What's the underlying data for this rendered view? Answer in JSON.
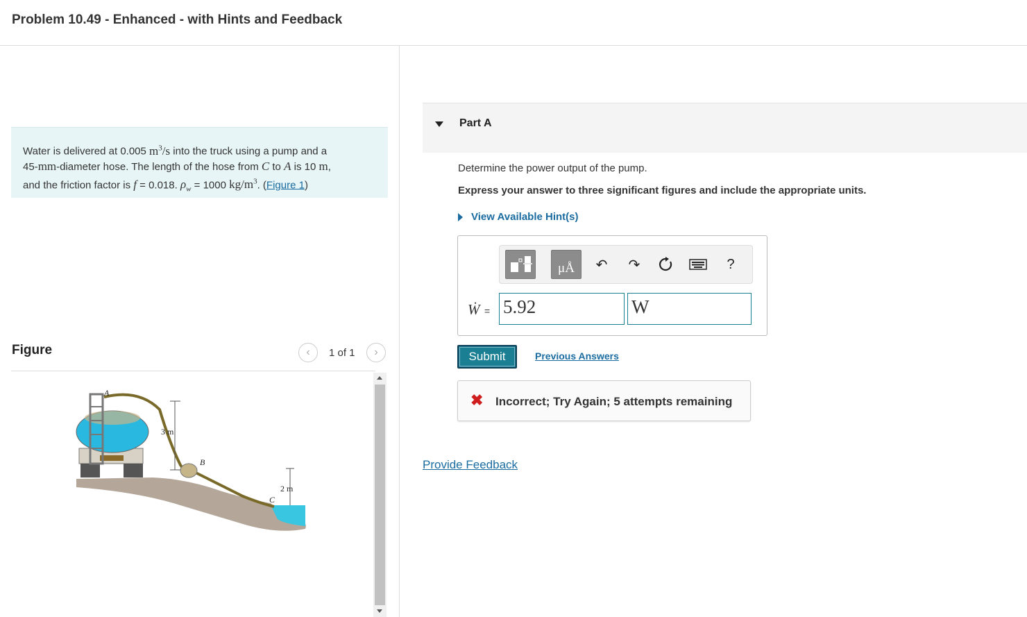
{
  "header": {
    "title": "Problem 10.49 - Enhanced - with Hints and Feedback"
  },
  "problem": {
    "t1": "Water is delivered at 0.005 ",
    "m3s_m": "m",
    "m3s_exp": "3",
    "m3s_s": "/s",
    "t2": " into the truck using a pump and a",
    "mm": "45-",
    "mm_unit": "mm",
    "t3": "-diameter hose. The length of the hose from ",
    "c": "C",
    "t4": " to ",
    "a": "A",
    "t5": " is 10 ",
    "m": "m",
    "t6": ",",
    "t7": "and the friction factor is ",
    "f": "f",
    "t8": " = 0.018. ",
    "rho": "ρ",
    "rho_sub": "w",
    "t9": " = 1000 ",
    "kg": "kg/m",
    "kg_exp": "3",
    "t10": ". (",
    "fig_link": "Figure 1",
    "t11": ")"
  },
  "figure": {
    "label": "Figure",
    "pager": "1 of 1",
    "prev_icon": "chevron-left-icon",
    "next_icon": "chevron-right-icon",
    "labels": {
      "a": "A",
      "b": "B",
      "c": "C",
      "h1": "3 m",
      "h2": "2 m"
    },
    "colors": {
      "tank": "#29b8e0",
      "water": "#38c6e0",
      "ground": "#b4a79a",
      "hose": "#7a6a2a"
    }
  },
  "part_a": {
    "title": "Part A",
    "question": "Determine the power output of the pump.",
    "instruction": "Express your answer to three significant figures and include the appropriate units.",
    "hint_label": "View Available Hint(s)",
    "toolbar": {
      "template_icon": "template-icon",
      "units_label": "μÅ",
      "undo_icon": "undo-icon",
      "redo_icon": "redo-icon",
      "reset_icon": "reset-icon",
      "keyboard_icon": "keyboard-icon",
      "help_label": "?"
    },
    "var_label": "Ẇ",
    "eq": "=",
    "value": "5.92",
    "unit": "W",
    "submit_label": "Submit",
    "previous_answers": "Previous Answers",
    "feedback": "Incorrect; Try Again; 5 attempts remaining",
    "provide_feedback": "Provide Feedback"
  },
  "colors": {
    "accent": "#1a7f93",
    "link": "#1a6ca0",
    "error": "#d01e1e"
  }
}
